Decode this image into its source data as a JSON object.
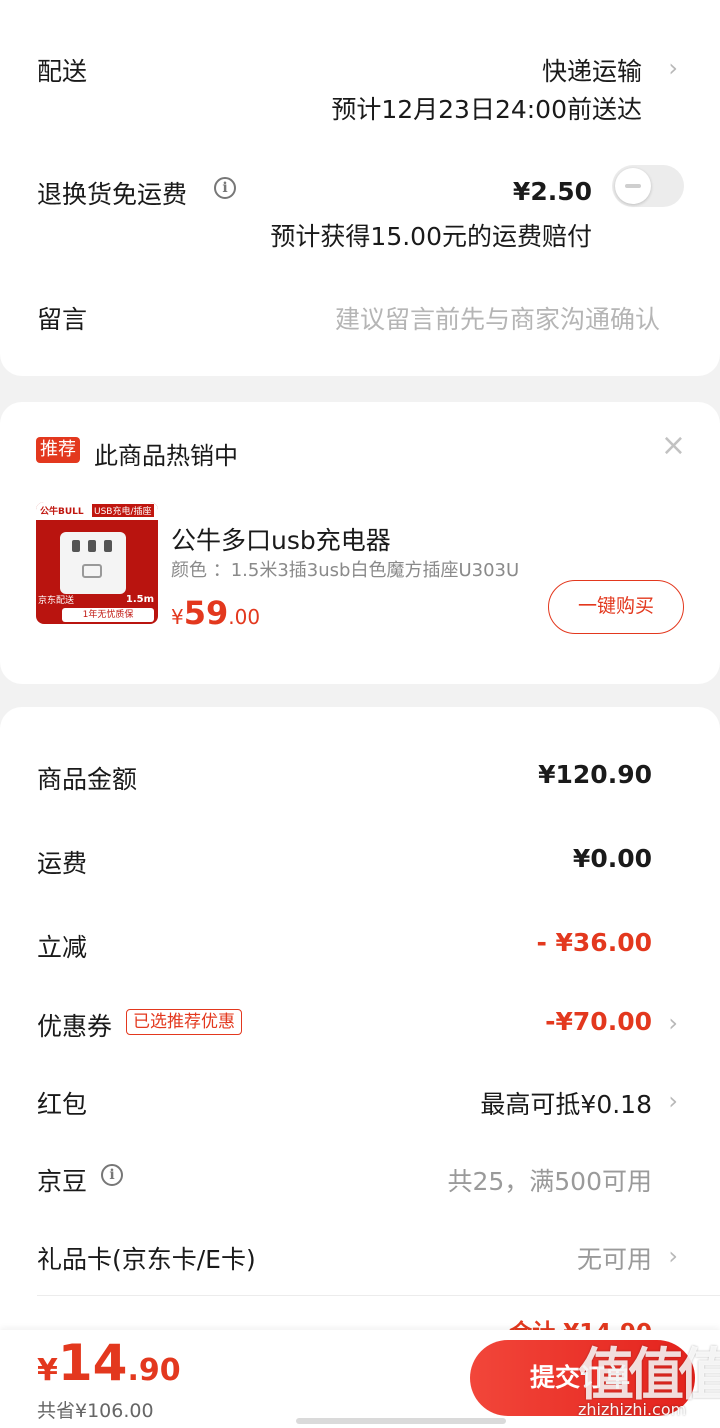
{
  "delivery": {
    "label": "配送",
    "method": "快递运输",
    "eta": "预计12月23日24:00前送达",
    "return_label": "退换货免运费",
    "return_price": "¥2.50",
    "return_note": "预计获得15.00元的运费赔付",
    "message_label": "留言",
    "message_placeholder": "建议留言前先与商家沟通确认"
  },
  "recommend": {
    "badge": "推荐",
    "title": "此商品热销中",
    "close": "×",
    "product": {
      "image_brand": "公牛BULL",
      "image_tag": "USB充电/插座",
      "image_size": "1.5m",
      "image_badge": "京东配送",
      "image_footer": "1年无忧质保",
      "name": "公牛多口usb充电器",
      "spec": "颜色 ：1.5米3插3usb白色魔方插座U303U",
      "price_symbol": "¥",
      "price_int": "59",
      "price_dec": ".00",
      "buy_label": "一键购买"
    }
  },
  "summary": {
    "rows": [
      {
        "label": "商品金额",
        "value": "¥120.90"
      },
      {
        "label": "运费",
        "value": "¥0.00"
      },
      {
        "label": "立减",
        "value": "- ¥36.00"
      },
      {
        "label": "优惠券",
        "tag": "已选推荐优惠",
        "value": "-¥70.00"
      },
      {
        "label": "红包",
        "value": "最高可抵¥0.18"
      },
      {
        "label": "京豆",
        "value": "共25，满500可用"
      },
      {
        "label": "礼品卡(京东卡/E卡)",
        "value": "无可用"
      }
    ],
    "total_partial": "合计 ¥14.90"
  },
  "bottom_bar": {
    "price_symbol": "¥",
    "price_int": "14",
    "price_dec": ".90",
    "saved": "共省¥106.00",
    "submit_label": "提交订单"
  },
  "watermark": {
    "logo": "值值值",
    "url": "zhizhizhi.com"
  },
  "colors": {
    "accent": "#e3381e",
    "background": "#f2f2f2"
  }
}
